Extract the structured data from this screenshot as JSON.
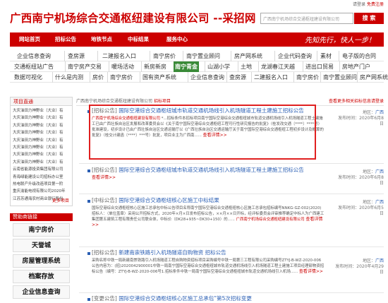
{
  "topbar": {
    "login": "请登录",
    "register": "免费注册"
  },
  "header": {
    "title": "广西南宁机场综合交通枢纽建设有限公司 --采招网",
    "search_placeholder": "广西南宁机场综合交通枢纽建设有限公司",
    "search_button": "搜 索"
  },
  "nav": {
    "items": [
      "网站首页",
      "招标公告",
      "地铁节点",
      "中标结果",
      "服务中心"
    ],
    "slogan": "先知先行，快人一步！"
  },
  "links": {
    "row1": [
      "企业信息查询",
      "查房源",
      "二建报名入口",
      "南宁房价",
      "南宁置业顾问",
      "房产网系统",
      "企业代码查询",
      "素材",
      "电子版的合同"
    ],
    "row2": [
      "交通枢纽站广告",
      "南宁房产交易",
      "暖场活动",
      "新房新房",
      "南宁青金",
      "山湖小学",
      "土地",
      "龙湖春江天越",
      "进出口贸易",
      "房地产门户"
    ],
    "row3": [
      "数据可视化",
      "什么是内测",
      "房价",
      "南宁房价",
      "国有资产系统",
      "企业信息查询",
      "查房源",
      "二建报名入口",
      "南宁房价",
      "南宁置业顾问",
      "房产网系统"
    ]
  },
  "sidebar": {
    "project_head": "项目直通",
    "projects": [
      "大庆油田力神野业（大业）有",
      "大庆油田力神野业（大业）有",
      "大庆油田力神野业（大业）有",
      "大庆油田力神野业（大业）有",
      "大庆油田力神野业（大业）有",
      "大庆油田力神野业（大业）有",
      "大庆油田力神野业（大业）有",
      "大庆油田力神野业（大业）有",
      "云南省能源投资集团有限公司",
      "青海绿能建设公司招标办公室",
      "热电联产升级改造项目第一阶",
      "重庆渝能电视有限公司2020年",
      "江苏苏通海农村商业银行股份"
    ],
    "more": "更多项目",
    "sponsor_head": "赞助商链接",
    "sponsors": [
      "南宁房价",
      "天誉城",
      "房屋管理系统",
      "档案存放",
      "企业信息查询"
    ]
  },
  "crumb": {
    "prefix": "广西南宁机场综合交通枢纽建设有限公司",
    "suffix": "招标项目",
    "right": "查看更多相关招标信息请登录"
  },
  "results": [
    {
      "tag": "[招标公告]",
      "title": "国际空港综合交通枢纽城市轨道交通机场线引入机场隧道工程土建施工招标公告",
      "body_kw": "广西南宁机场综合交通枢纽建设有限公司",
      "body": "*...招标条件本招标项目南宁国际空港综合交通枢纽城市轨道交通机场线引入机场隧道工程土建施工已由广西壮族自治区发展和改革委员会以《关于南宁国际空港综合交通枢纽工程可行性研究报告的批复》（桂发改交通〔****〕****号）批准建设，初步设计已由广西壮族自治区交通运输厅以《广西壮族自治区交通运输厅关于南宁国际空港综合交通枢纽工程初步设计及概算的批复》（桂交计建函〔****〕***号）批复，项目业主为广西南......",
      "more": "查看详情>>",
      "region": "广西",
      "date": "2020年6月8日"
    },
    {
      "tag": "[招标公告]",
      "title": "国际空港综合交通枢纽城市轨道交通机场线引入机场隧道工程土建施工招标公告",
      "more": "查看详情>>",
      "region": "广西",
      "date": "2020年6月8日"
    },
    {
      "tag": "[中标公告]",
      "title": "国际空港综合交通枢纽核心区施工中标结果",
      "body_kw": "广西南宁机场综合交通枢纽建设有限公司",
      "body": "国际空港综合交通枢纽核心区施工总承包中标公告项目名称南宁国际空港综合交通枢纽核心区施工总承包招标编号NNKG-GZ-002(2020)招标人：（单位盖章）采用公开招标方式，2020年×月×日发布招标公告，××月××日开标，经评标委员会评审推荐确定中标人为广西建工集团第五建筑工程有限责任公司联合体，中标价（DK28+935~DK30+150）的......",
      "more": "查看详情>>",
      "region": "广西",
      "date": "2020年6月5日"
    },
    {
      "tag": "[招标公告]",
      "title": "新建南崇铁路引入机场隧道自购物资 招标公告",
      "body": "采购名称中铁一局新建南崇铁路引入机场隧道工程自购物资招标项目采购编号中铁一局第三工程有限公司采购编号ZTYJ-B-WZ-2020-006公告内容为：(招)2020042900001中铁一局南宁国际空港综合交通枢纽城市轨道交通机场线引入机场隧道工程土建施工项目经理部物资招标公告（编号：ZTYJ-B-WZ-2020-006号1.招标条件中铁一局南宁国际空港综合交通枢纽城市轨道交通机场线引入机场......",
      "more": "查看详情>>",
      "region": "广西",
      "date": "2020年4月29日"
    },
    {
      "tag": "[变更公告]",
      "title": "国际空港综合交通枢纽核心区施工总承包”第5次招标变更"
    }
  ],
  "labels": {
    "region_prefix": "地区：",
    "date_prefix": "发布时间："
  }
}
